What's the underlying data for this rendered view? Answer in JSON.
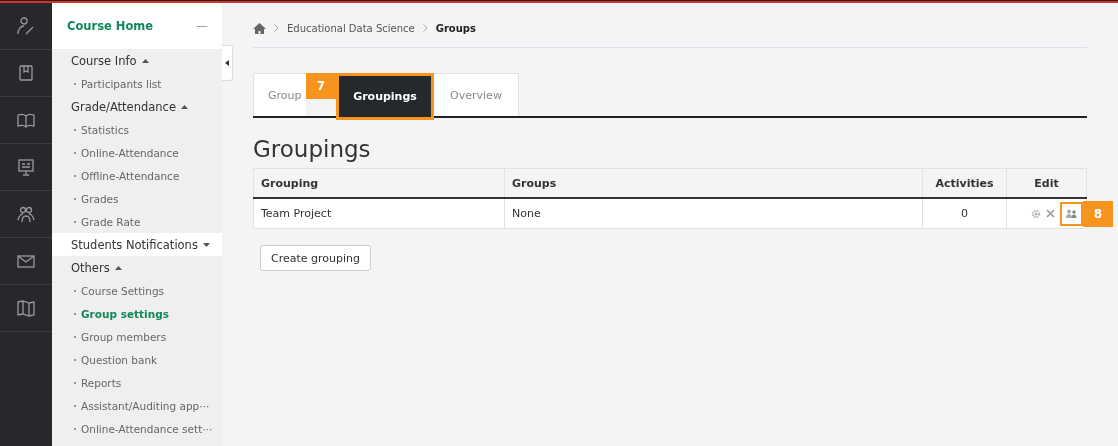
{
  "rail": {
    "icons": [
      {
        "kind": "person-pen"
      },
      {
        "kind": "notebook"
      },
      {
        "kind": "book"
      },
      {
        "kind": "board"
      },
      {
        "kind": "people"
      },
      {
        "kind": "mail"
      },
      {
        "kind": "map"
      }
    ]
  },
  "sidebar": {
    "title": "Course Home",
    "collapse": "—",
    "sections": [
      {
        "label": "Course Info",
        "expanded": true,
        "items": [
          {
            "label": "Participants list",
            "selected": false
          }
        ]
      },
      {
        "label": "Grade/Attendance",
        "expanded": true,
        "items": [
          {
            "label": "Statistics",
            "selected": false
          },
          {
            "label": "Online-Attendance",
            "selected": false
          },
          {
            "label": "Offline-Attendance",
            "selected": false
          },
          {
            "label": "Grades",
            "selected": false
          },
          {
            "label": "Grade Rate",
            "selected": false
          }
        ]
      },
      {
        "label": "Students Notifications",
        "expanded": false
      },
      {
        "label": "Others",
        "expanded": true,
        "items": [
          {
            "label": "Course Settings",
            "selected": false
          },
          {
            "label": "Group settings",
            "selected": true
          },
          {
            "label": "Group members",
            "selected": false
          },
          {
            "label": "Question bank",
            "selected": false
          },
          {
            "label": "Reports",
            "selected": false
          },
          {
            "label": "Assistant/Auditing app···",
            "selected": false
          },
          {
            "label": "Online-Attendance sett···",
            "selected": false
          }
        ]
      }
    ]
  },
  "breadcrumb": [
    "Educational Data Science",
    "Groups"
  ],
  "tabs": [
    {
      "label": "Group",
      "selected": false
    },
    {
      "label": "Groupings",
      "selected": true,
      "callout": "7"
    },
    {
      "label": "Overview",
      "selected": false
    }
  ],
  "heading": "Groupings",
  "table": {
    "columns": [
      "Grouping",
      "Groups",
      "Activities",
      "Edit"
    ],
    "rows": [
      {
        "cells": [
          "Team Project",
          "None",
          "0"
        ],
        "actions": [
          {
            "kind": "settings"
          },
          {
            "kind": "delete"
          },
          {
            "kind": "members",
            "callout": "8"
          }
        ]
      }
    ]
  },
  "create_button": "Create grouping"
}
